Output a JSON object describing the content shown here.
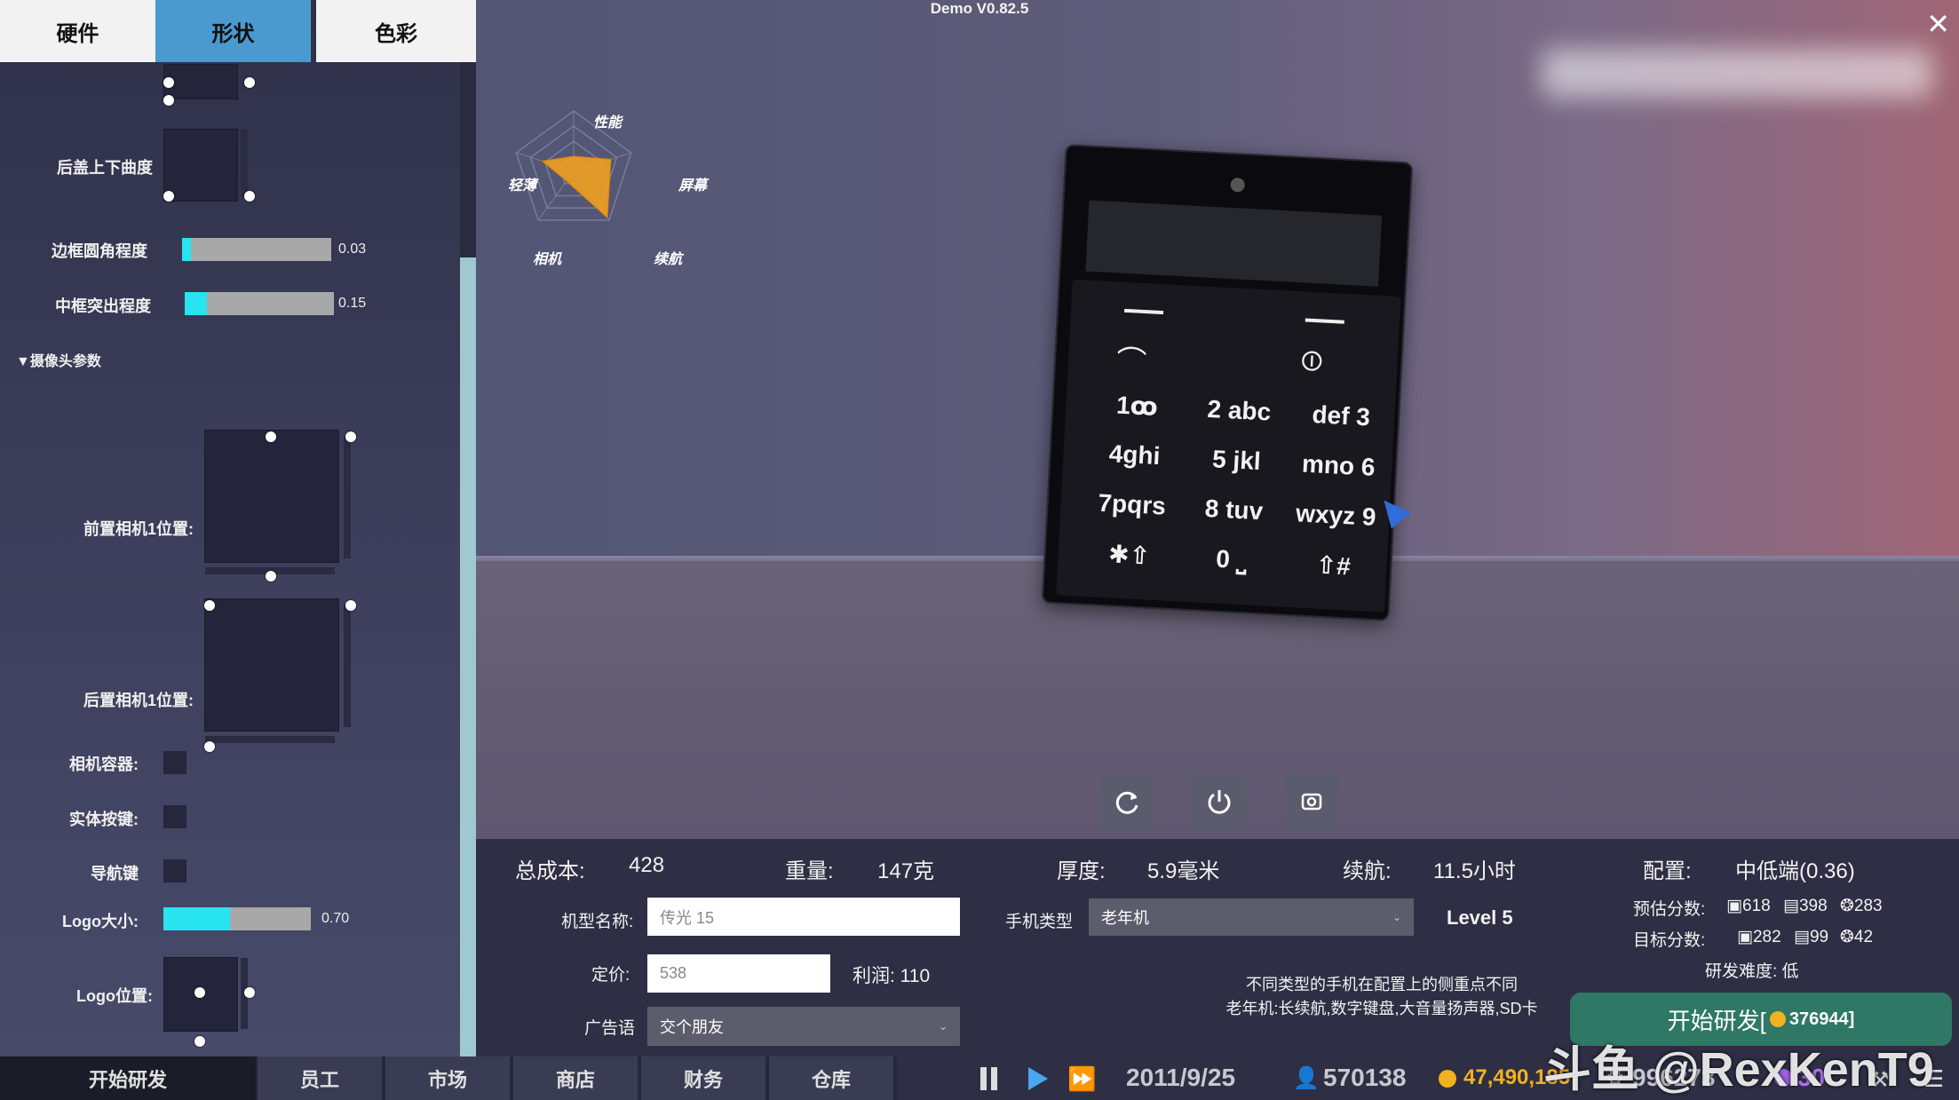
{
  "window": {
    "version": "Demo V0.82.5",
    "close_icon": "close-icon"
  },
  "tabs": [
    {
      "label": "硬件"
    },
    {
      "label": "形状"
    },
    {
      "label": "色彩"
    }
  ],
  "sidebar": {
    "back_cover_curve_label": "后盖上下曲度",
    "frame_corner": {
      "label": "边框圆角程度",
      "value": "0.03",
      "fraction": 0.03
    },
    "mid_frame": {
      "label": "中框突出程度",
      "value": "0.15",
      "fraction": 0.15
    },
    "camera_section": "▼摄像头参数",
    "front_camera_label": "前置相机1位置:",
    "rear_camera_label": "后置相机1位置:",
    "camera_housing_label": "相机容器:",
    "physical_keys_label": "实体按键:",
    "nav_keys_label": "导航键",
    "logo_size": {
      "label": "Logo大小:",
      "value": "0.70",
      "fraction": 0.45
    },
    "logo_position_label": "Logo位置:"
  },
  "radar": {
    "labels": {
      "top": "性能",
      "right": "屏幕",
      "bottom_right": "续航",
      "bottom_left": "相机",
      "left": "轻薄"
    },
    "values": [
      0.25,
      0.65,
      0.95,
      0.2,
      0.55
    ],
    "color": "#f0a020"
  },
  "phone": {
    "keys": [
      [
        "1ꝏ",
        "2 abc",
        "def 3"
      ],
      [
        "4ghi",
        "5 jkl",
        "mno 6"
      ],
      [
        "7pqrs",
        "8 tuv",
        "wxyz 9"
      ],
      [
        "✱⇧",
        "0 ⎵",
        "⇧#"
      ]
    ]
  },
  "controls": {
    "rotate_icon": "rotate-icon",
    "power_icon": "power-icon",
    "screenshot_icon": "screenshot-icon"
  },
  "stats": {
    "cost_label": "总成本:",
    "cost": "428",
    "weight_label": "重量:",
    "weight": "147克",
    "thickness_label": "厚度:",
    "thickness": "5.9毫米",
    "battery_label": "续航:",
    "battery": "11.5小时",
    "config_label": "配置:",
    "config": "中低端(0.36)"
  },
  "form": {
    "model_name_label": "机型名称:",
    "model_name_placeholder": "传光 15",
    "price_label": "定价:",
    "price_placeholder": "538",
    "profit_label": "利润: 110",
    "ad_label": "广告语",
    "ad_value": "交个朋友",
    "phone_type_label": "手机类型",
    "phone_type_value": "老年机",
    "level": "Level 5",
    "hint_line1": "不同类型的手机在配置上的侧重点不同",
    "hint_line2": "老年机:长续航,数字键盘,大音量扬声器,SD卡"
  },
  "scores": {
    "estimated_label": "预估分数:",
    "estimated": [
      "▣618",
      "▤398",
      "❂283"
    ],
    "target_label": "目标分数:",
    "target": [
      "▣282",
      "▤99",
      "❂42"
    ],
    "difficulty": "研发难度:  低"
  },
  "start_button": {
    "label": "开始研发[",
    "cost": "376944]"
  },
  "bottom": {
    "nav": [
      "开始研发",
      "员工",
      "市场",
      "商店",
      "财务",
      "仓库"
    ],
    "date": "2011/9/25",
    "fans": "570138",
    "money": "47,490,185",
    "research": "996273",
    "gems": "30"
  },
  "watermark": "斗鱼 @RexKenT9"
}
